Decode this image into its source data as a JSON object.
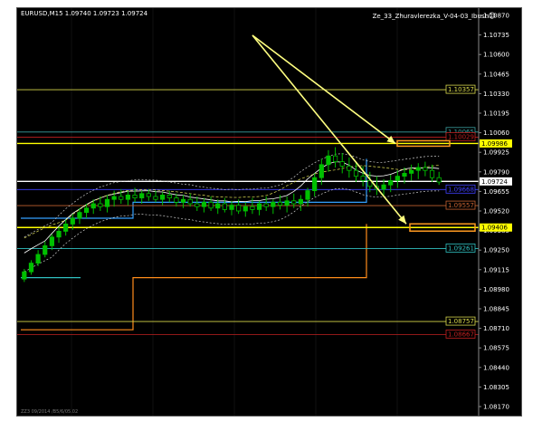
{
  "symbol_header": "EURUSD,M15  1.09740 1.09723 1.09724",
  "indicator_label": "Ze_33_Zhuravlerezka_V-04-03_Ibush",
  "indicator_icon": "smiley-icon",
  "footer_text": "ZZ3 09/2014 /B5/6/05.02",
  "colors": {
    "background": "#000000",
    "candle": "#00c000",
    "grid": "#333333",
    "arrow": "#ffff80"
  },
  "chart_data": {
    "type": "candlestick",
    "price_axis": [
      "1.10870",
      "1.10735",
      "1.10600",
      "1.10465",
      "1.10330",
      "1.10195",
      "1.10060",
      "1.09925",
      "1.09790",
      "1.09655",
      "1.09520",
      "1.09385",
      "1.09250",
      "1.09115",
      "1.08980",
      "1.08845",
      "1.08710",
      "1.08575",
      "1.08440",
      "1.08305",
      "1.08170"
    ],
    "ylim": [
      1.0817,
      1.1087
    ],
    "current_price": "1.09724",
    "levels": [
      {
        "value": 1.10357,
        "label": "1.10357",
        "color": "#d6d64a"
      },
      {
        "value": 1.10065,
        "label": "1.10065",
        "color": "#3aa0a0"
      },
      {
        "value": 1.10029,
        "label": "1.10029",
        "color": "#c02020"
      },
      {
        "value": 1.09986,
        "label": "1.09986",
        "color": "#ffff00",
        "highlight": true
      },
      {
        "value": 1.09724,
        "label": "1.09724",
        "color": "#ffffff",
        "highlight": true
      },
      {
        "value": 1.09668,
        "label": "1.09668",
        "color": "#4040ff"
      },
      {
        "value": 1.09557,
        "label": "1.09557",
        "color": "#c06030"
      },
      {
        "value": 1.09406,
        "label": "1.09406",
        "color": "#ffff00",
        "highlight": true
      },
      {
        "value": 1.09261,
        "label": "1.09261",
        "color": "#30c0c0"
      },
      {
        "value": 1.08757,
        "label": "1.08757",
        "color": "#d6d64a"
      },
      {
        "value": 1.08667,
        "label": "1.08667",
        "color": "#c02020"
      }
    ],
    "candles": [
      [
        1.0905,
        1.0912,
        1.0903,
        1.091
      ],
      [
        1.091,
        1.0918,
        1.0908,
        1.0916
      ],
      [
        1.0916,
        1.0925,
        1.0914,
        1.0922
      ],
      [
        1.0922,
        1.0931,
        1.092,
        1.0928
      ],
      [
        1.0928,
        1.0936,
        1.0925,
        1.0934
      ],
      [
        1.0934,
        1.0941,
        1.093,
        1.0938
      ],
      [
        1.0938,
        1.0946,
        1.0935,
        1.0943
      ],
      [
        1.0943,
        1.095,
        1.0939,
        1.0947
      ],
      [
        1.0947,
        1.0954,
        1.0943,
        1.0951
      ],
      [
        1.0951,
        1.0957,
        1.0947,
        1.0954
      ],
      [
        1.0954,
        1.096,
        1.095,
        1.0957
      ],
      [
        1.0957,
        1.0962,
        1.0952,
        1.0955
      ],
      [
        1.0955,
        1.0963,
        1.0951,
        1.096
      ],
      [
        1.096,
        1.0966,
        1.0955,
        1.0962
      ],
      [
        1.0962,
        1.0967,
        1.0957,
        1.096
      ],
      [
        1.096,
        1.0966,
        1.0956,
        1.0963
      ],
      [
        1.0963,
        1.0968,
        1.0958,
        1.0961
      ],
      [
        1.0961,
        1.0966,
        1.0957,
        1.0964
      ],
      [
        1.0964,
        1.0967,
        1.0959,
        1.0962
      ],
      [
        1.0962,
        1.0966,
        1.0958,
        1.096
      ],
      [
        1.096,
        1.0965,
        1.0956,
        1.0963
      ],
      [
        1.0963,
        1.0966,
        1.0958,
        1.0961
      ],
      [
        1.0961,
        1.0964,
        1.0955,
        1.0958
      ],
      [
        1.0958,
        1.0963,
        1.0954,
        1.096
      ],
      [
        1.096,
        1.0964,
        1.0955,
        1.0957
      ],
      [
        1.0957,
        1.0962,
        1.0952,
        1.0955
      ],
      [
        1.0955,
        1.0961,
        1.0951,
        1.0958
      ],
      [
        1.0958,
        1.0962,
        1.0952,
        1.0954
      ],
      [
        1.0954,
        1.096,
        1.095,
        1.0957
      ],
      [
        1.0957,
        1.0961,
        1.0951,
        1.0953
      ],
      [
        1.0953,
        1.0959,
        1.0949,
        1.0956
      ],
      [
        1.0956,
        1.096,
        1.095,
        1.0952
      ],
      [
        1.0952,
        1.0958,
        1.0948,
        1.0955
      ],
      [
        1.0955,
        1.0961,
        1.095,
        1.0953
      ],
      [
        1.0953,
        1.0959,
        1.0949,
        1.0957
      ],
      [
        1.0957,
        1.0962,
        1.0952,
        1.0955
      ],
      [
        1.0955,
        1.096,
        1.095,
        1.0958
      ],
      [
        1.0958,
        1.0963,
        1.0953,
        1.0956
      ],
      [
        1.0956,
        1.0962,
        1.0951,
        1.0959
      ],
      [
        1.0959,
        1.0964,
        1.0954,
        1.0957
      ],
      [
        1.0957,
        1.0963,
        1.0952,
        1.096
      ],
      [
        1.096,
        1.0968,
        1.0955,
        1.0966
      ],
      [
        1.0966,
        1.0978,
        1.0962,
        1.0975
      ],
      [
        1.0975,
        1.0988,
        1.097,
        1.0984
      ],
      [
        1.0984,
        1.0994,
        1.0979,
        1.099
      ],
      [
        1.099,
        1.0996,
        1.0982,
        1.0986
      ],
      [
        1.0986,
        1.0992,
        1.0978,
        1.0983
      ],
      [
        1.0983,
        1.0989,
        1.0975,
        1.098
      ],
      [
        1.098,
        1.0986,
        1.0972,
        1.0976
      ],
      [
        1.0976,
        1.0983,
        1.0969,
        1.0973
      ],
      [
        1.0973,
        1.0979,
        1.0965,
        1.0969
      ],
      [
        1.0969,
        1.0976,
        1.0963,
        1.0967
      ],
      [
        1.0967,
        1.0974,
        1.0962,
        1.097
      ],
      [
        1.097,
        1.0977,
        1.0965,
        1.0973
      ],
      [
        1.0973,
        1.098,
        1.0968,
        1.0976
      ],
      [
        1.0976,
        1.0982,
        1.0971,
        1.0978
      ],
      [
        1.0978,
        1.0984,
        1.0973,
        1.098
      ],
      [
        1.098,
        1.0985,
        1.0974,
        1.0982
      ],
      [
        1.0982,
        1.0986,
        1.0976,
        1.098
      ],
      [
        1.098,
        1.0984,
        1.0972,
        1.0975
      ],
      [
        1.0975,
        1.0979,
        1.097,
        1.0972
      ]
    ]
  }
}
